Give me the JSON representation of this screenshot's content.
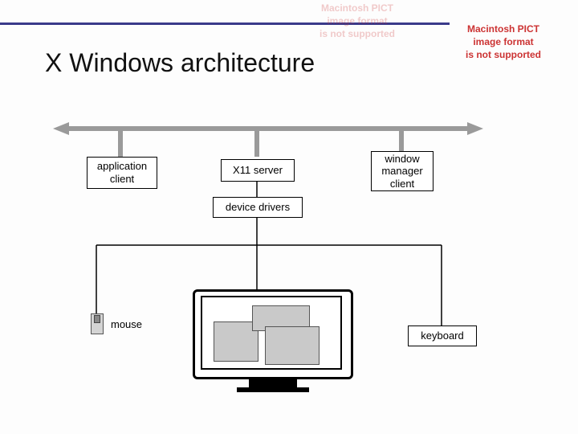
{
  "title": "X Windows architecture",
  "errors": {
    "pict": "Macintosh PICT\nimage format\nis not supported"
  },
  "nodes": {
    "app_client": "application\nclient",
    "x11_server": "X11 server",
    "wm_client": "window\nmanager\nclient",
    "device_drivers": "device drivers",
    "mouse": "mouse",
    "keyboard": "keyboard"
  },
  "colors": {
    "rule": "#3a3a8a",
    "bus": "#9a9a9a",
    "window_fill": "#c9c9c9"
  }
}
